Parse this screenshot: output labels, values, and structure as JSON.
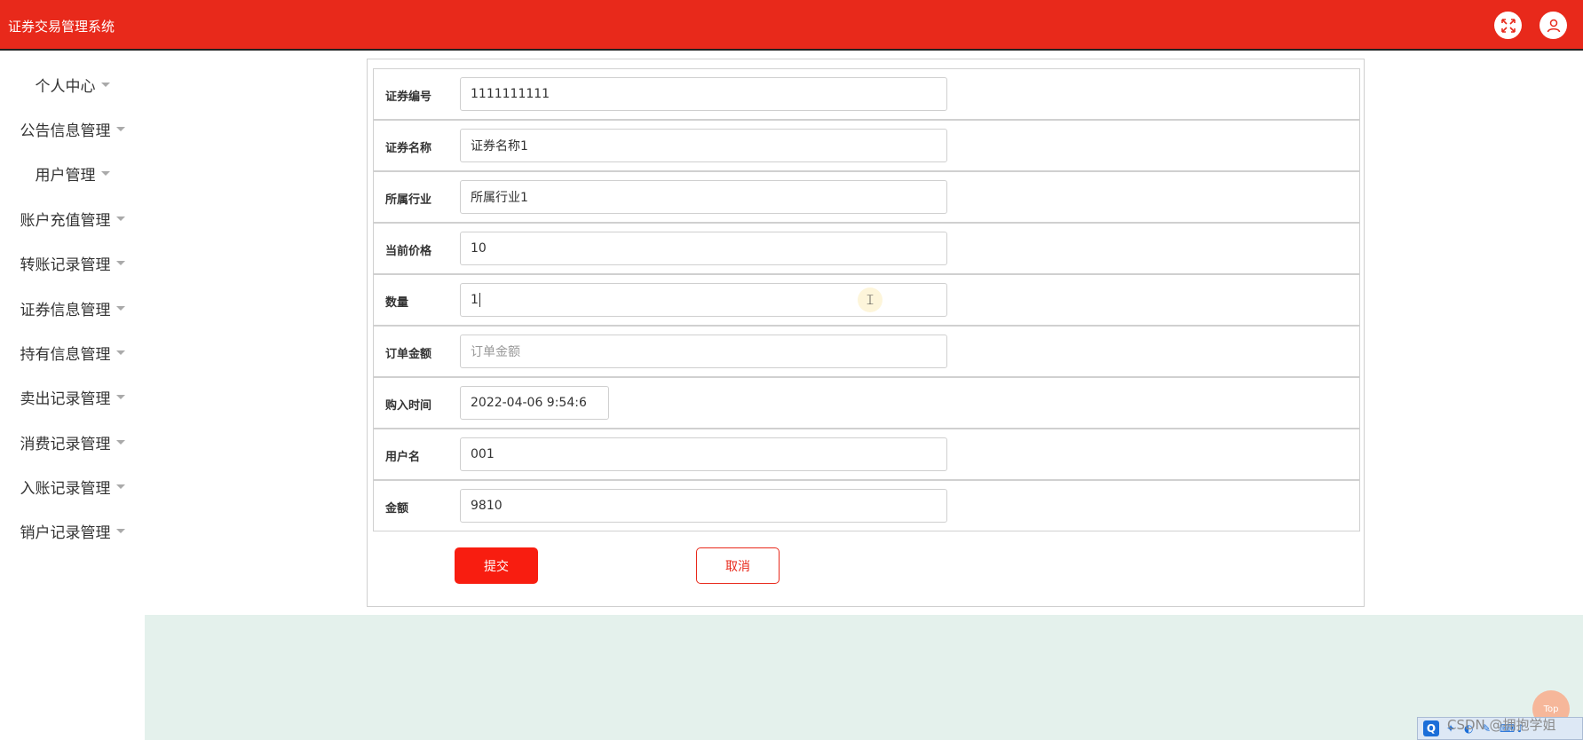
{
  "header": {
    "title": "证券交易管理系统",
    "fullscreen_icon": "fullscreen-icon",
    "user_icon": "user-avatar-icon"
  },
  "sidebar": {
    "items": [
      {
        "label": "个人中心"
      },
      {
        "label": "公告信息管理"
      },
      {
        "label": "用户管理"
      },
      {
        "label": "账户充值管理"
      },
      {
        "label": "转账记录管理"
      },
      {
        "label": "证券信息管理"
      },
      {
        "label": "持有信息管理"
      },
      {
        "label": "卖出记录管理"
      },
      {
        "label": "消费记录管理"
      },
      {
        "label": "入账记录管理"
      },
      {
        "label": "销户记录管理"
      }
    ]
  },
  "form": {
    "fields": [
      {
        "label": "证券编号",
        "value": "1111111111",
        "placeholder": ""
      },
      {
        "label": "证券名称",
        "value": "证券名称1",
        "placeholder": ""
      },
      {
        "label": "所属行业",
        "value": "所属行业1",
        "placeholder": ""
      },
      {
        "label": "当前价格",
        "value": "10",
        "placeholder": ""
      },
      {
        "label": "数量",
        "value": "1",
        "placeholder": ""
      },
      {
        "label": "订单金额",
        "value": "",
        "placeholder": "订单金额"
      },
      {
        "label": "购入时间",
        "value": "2022-04-06 9:54:6",
        "placeholder": ""
      },
      {
        "label": "用户名",
        "value": "001",
        "placeholder": ""
      },
      {
        "label": "金额",
        "value": "9810",
        "placeholder": ""
      }
    ],
    "submit_label": "提交",
    "cancel_label": "取消"
  },
  "overlay": {
    "to_top_label": "Top",
    "watermark": "CSDN @拥抱学姐",
    "tray_icon": "Q"
  },
  "colors": {
    "primary": "#e8291b",
    "submit": "#f81d10",
    "footer_bg": "#e4f1ec"
  }
}
